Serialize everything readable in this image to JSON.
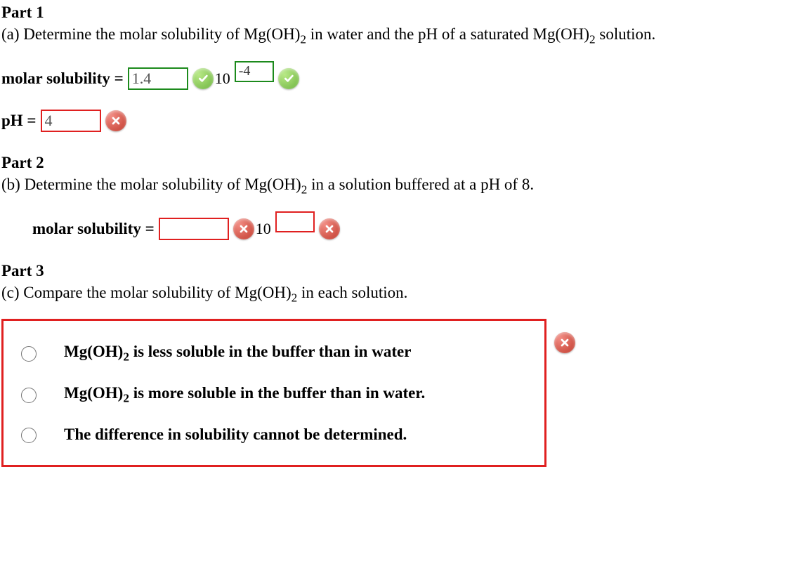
{
  "part1": {
    "header": "Part 1",
    "prompt_a": "(a) Determine the molar solubility of Mg(OH)",
    "sub2a": "2",
    "prompt_b": " in water and the pH of a saturated Mg(OH)",
    "sub2b": "2",
    "prompt_c": " solution.",
    "molar_label": "molar solubility = ",
    "molar_value": "1.4",
    "ten_label": "10",
    "exp_value": "-4",
    "ph_label": "pH = ",
    "ph_value": "4"
  },
  "part2": {
    "header": "Part 2",
    "prompt_a": "(b) Determine the molar solubility of Mg(OH)",
    "sub2": "2",
    "prompt_b": " in a solution buffered at a pH of 8.",
    "molar_label": "molar solubility = ",
    "molar_value": "",
    "ten_label": "10",
    "exp_value": ""
  },
  "part3": {
    "header": "Part 3",
    "prompt_a": "(c) Compare the molar solubility of Mg(OH)",
    "sub2": "2",
    "prompt_b": " in each solution.",
    "options": {
      "opt1_a": "Mg(OH)",
      "opt1_sub": "2",
      "opt1_b": " is less soluble in the buffer than in water",
      "opt2_a": "Mg(OH)",
      "opt2_sub": "2",
      "opt2_b": " is more soluble in the buffer than in water.",
      "opt3": "The difference in solubility cannot be determined."
    }
  }
}
